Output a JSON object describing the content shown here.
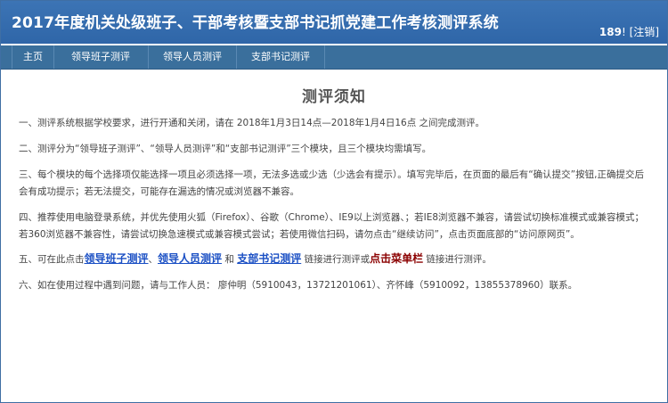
{
  "header": {
    "title": "2017年度机关处级班子、干部考核暨支部书记抓党建工作考核测评系统",
    "user_id": "189",
    "user_suffix": "! [",
    "logout": "注销",
    "user_close": "]"
  },
  "nav": {
    "items": [
      {
        "label": "主页"
      },
      {
        "label": "领导班子测评"
      },
      {
        "label": "领导人员测评"
      },
      {
        "label": "支部书记测评"
      }
    ]
  },
  "notice": {
    "title": "测评须知",
    "p1": "一、测评系统根据学校要求，进行开通和关闭，请在 2018年1月3日14点—2018年1月4日16点 之间完成测评。",
    "p2": "二、测评分为“领导班子测评”、“领导人员测评”和“支部书记测评”三个模块，且三个模块均需填写。",
    "p3": "三、每个模块的每个选择项仅能选择一项且必须选择一项，无法多选或少选（少选会有提示）。填写完毕后，在页面的最后有“确认提交”按钮,正确提交后会有成功提示；若无法提交，可能存在漏选的情况或浏览器不兼容。",
    "p4": "四、推荐使用电脑登录系统，并优先使用火狐（Firefox）、谷歌（Chrome）、IE9以上浏览器、；若IE8浏览器不兼容，请尝试切换标准模式或兼容模式；若360浏览器不兼容性，请尝试切换急速模式或兼容模式尝试；若使用微信扫码，请勿点击“继续访问”，点击页面底部的“访问原网页”。",
    "p5": {
      "prefix": "五、可在此点击",
      "link1": "领导班子测评",
      "sep1": "、",
      "link2": "领导人员测评",
      "sep2": " 和 ",
      "link3": "支部书记测评",
      "mid": " 链接进行测评或",
      "link4": "点击菜单栏",
      "suffix": " 链接进行测评。"
    },
    "p6": "六、如在使用过程中遇到问题，请与工作人员：  廖仲明（5910043，13721201061）、齐怀峰（5910092，13855378960）联系。"
  }
}
